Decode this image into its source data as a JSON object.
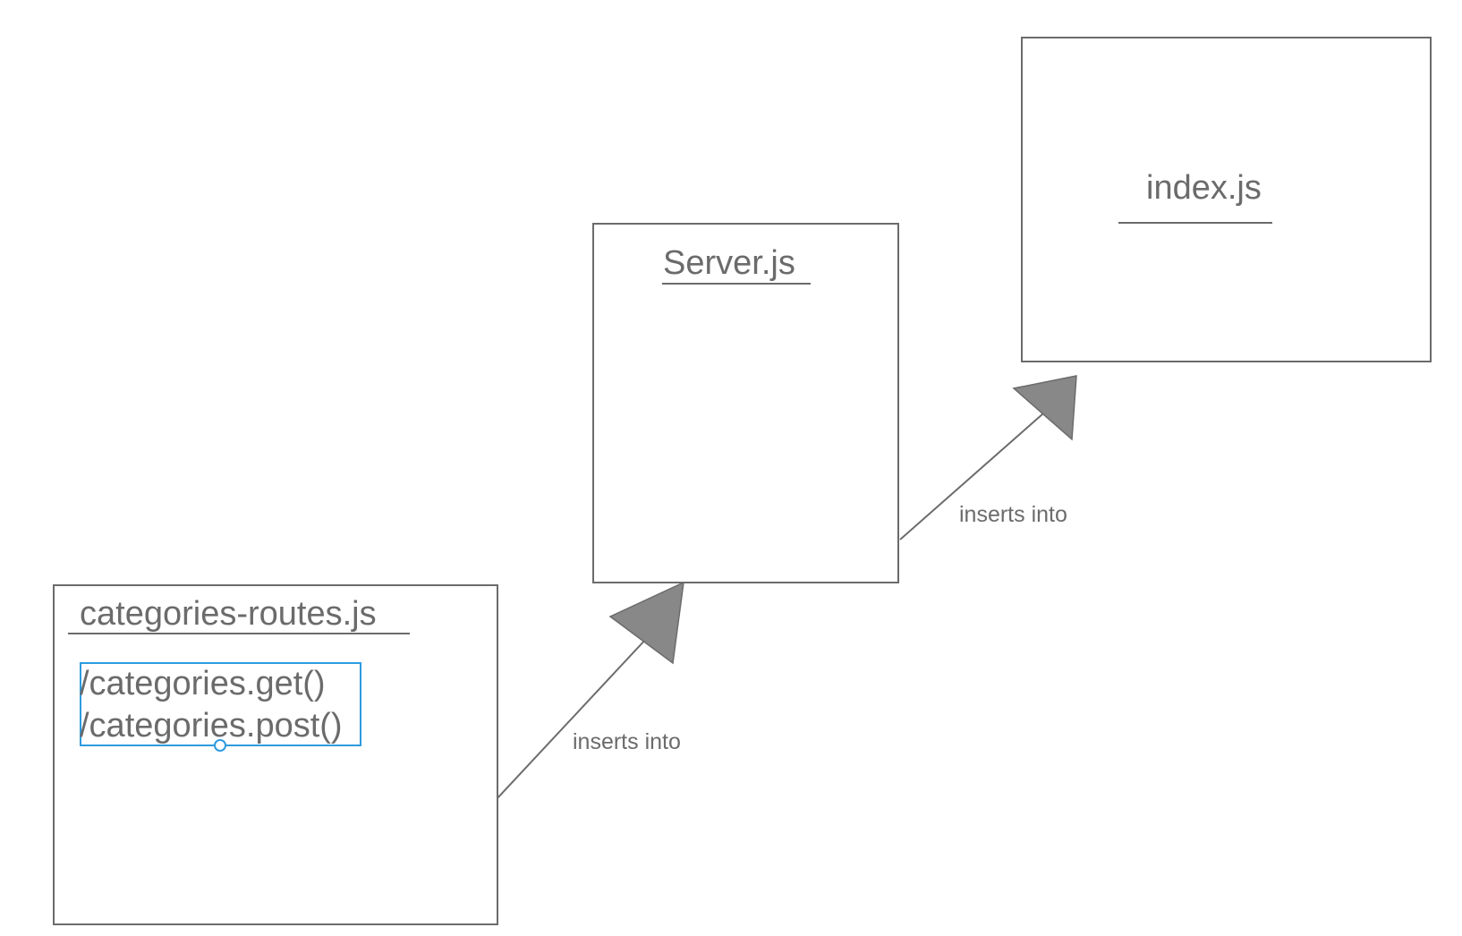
{
  "diagram": {
    "nodes": {
      "categories_routes": {
        "title": "categories-routes.js",
        "methods": [
          "/categories.get()",
          "/categories.post()"
        ]
      },
      "server": {
        "title": "Server.js"
      },
      "index": {
        "title": "index.js"
      }
    },
    "edges": [
      {
        "from": "categories-routes.js",
        "to": "Server.js",
        "label": "inserts into"
      },
      {
        "from": "Server.js",
        "to": "index.js",
        "label": "inserts into"
      }
    ]
  },
  "colors": {
    "stroke": "#6b6b6b",
    "text": "#6b6b6b",
    "arrowhead_fill": "#888888",
    "selection": "#2d9be0",
    "background": "#ffffff"
  }
}
